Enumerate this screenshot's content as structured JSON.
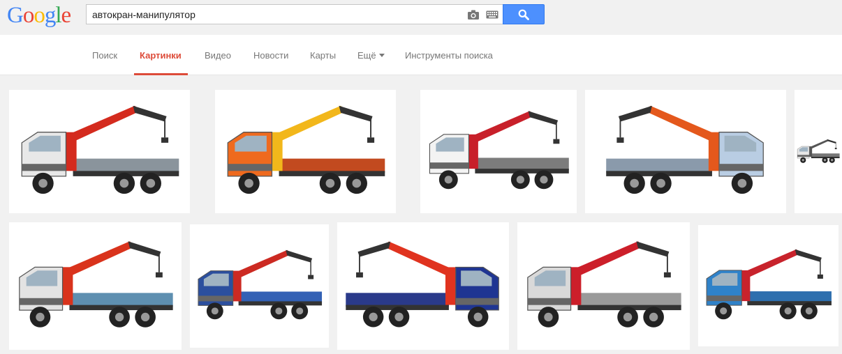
{
  "logo": {
    "letters": [
      "G",
      "o",
      "o",
      "g",
      "l",
      "e"
    ]
  },
  "search": {
    "query": "автокран-манипулятор"
  },
  "icons": {
    "camera": "camera-icon",
    "keyboard": "keyboard-icon",
    "search": "magnifier-icon"
  },
  "nav": {
    "tabs": [
      {
        "label": "Поиск"
      },
      {
        "label": "Картинки",
        "active": true
      },
      {
        "label": "Видео"
      },
      {
        "label": "Новости"
      },
      {
        "label": "Карты"
      },
      {
        "label": "Ещё"
      },
      {
        "label": "Инструменты поиска"
      }
    ]
  },
  "colors": {
    "accent": "#dd4b39",
    "search_button": "#4d90fe",
    "background": "#f1f1f1"
  },
  "results": [
    {
      "cab": "#e8e8e8",
      "boom": "#d42b1e",
      "bed": "#8a949c"
    },
    {
      "cab": "#ef6a1e",
      "boom": "#f2b71b",
      "bed": "#c24a1f"
    },
    {
      "cab": "#f3f3f3",
      "boom": "#c8202a",
      "bed": "#7c7c7c"
    },
    {
      "cab": "#b9cde3",
      "boom": "#e4581c",
      "bed": "#8a9aab"
    },
    {
      "cab": "#e6e6e6",
      "boom": "#555555",
      "bed": "#777777"
    },
    {
      "cab": "#e3e3e3",
      "boom": "#d9331c",
      "bed": "#5e8fb0"
    },
    {
      "cab": "#2b4f9e",
      "boom": "#cc2a22",
      "bed": "#3361b5"
    },
    {
      "cab": "#1f3592",
      "boom": "#e0331f",
      "bed": "#2a3a8a"
    },
    {
      "cab": "#d9d9d9",
      "boom": "#cc1f2a",
      "bed": "#9a9a9a"
    },
    {
      "cab": "#2f82c9",
      "boom": "#c8232c",
      "bed": "#2e6fae"
    }
  ]
}
